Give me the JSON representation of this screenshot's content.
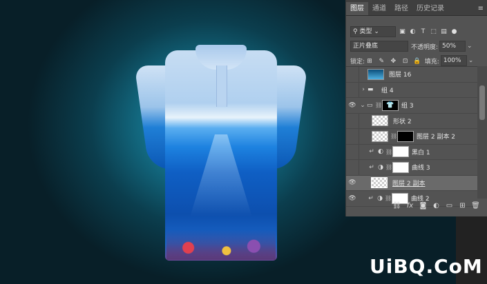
{
  "tabs": [
    {
      "label": "图层",
      "active": true
    },
    {
      "label": "通道",
      "active": false
    },
    {
      "label": "路径",
      "active": false
    },
    {
      "label": "历史记录",
      "active": false
    }
  ],
  "filter": {
    "kind": "类型"
  },
  "blend": {
    "mode": "正片叠底",
    "opacity_label": "不透明度:",
    "opacity": "50%"
  },
  "lock": {
    "label": "锁定:",
    "fill_label": "填充:",
    "fill": "100%"
  },
  "layers": [
    {
      "name": "图层 16",
      "visible": false
    },
    {
      "name": "组 4",
      "visible": false
    },
    {
      "name": "组 3",
      "visible": true
    },
    {
      "name": "形状 2",
      "visible": false
    },
    {
      "name": "图层 2 副本 2",
      "visible": false
    },
    {
      "name": "黑白 1",
      "visible": false
    },
    {
      "name": "曲线 3",
      "visible": false
    },
    {
      "name": "图层 2 副本",
      "visible": true,
      "selected": true
    },
    {
      "name": "曲线 2",
      "visible": true
    }
  ],
  "footer_icons": [
    "link-icon",
    "fx-icon",
    "mask-icon",
    "adjustment-icon",
    "folder-icon",
    "new-layer-icon",
    "trash-icon"
  ],
  "watermark": "UiBQ.CoM",
  "colors": {
    "panel": "#535353",
    "tabbar": "#3f3f3f",
    "selected": "#6a6a6a"
  }
}
